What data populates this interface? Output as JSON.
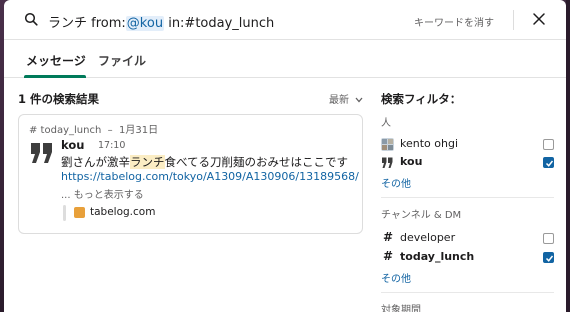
{
  "search": {
    "query_keyword": "ランチ",
    "query_from_label": "from:",
    "query_from_value": "@kou",
    "query_in": "in:#today_lunch",
    "clear_label": "キーワードを消す"
  },
  "tabs": [
    {
      "label": "メッセージ",
      "active": true
    },
    {
      "label": "ファイル",
      "active": false
    }
  ],
  "results": {
    "title": "1 件の検索結果",
    "sort_label": "最新"
  },
  "result": {
    "channel": "# today_lunch",
    "separator": "–",
    "date": "1月31日",
    "author": "kou",
    "time": "17:10",
    "text_before": "劉さんが激辛",
    "text_keyword": "ランチ",
    "text_after": "食べてる刀削麺のおみせはここです",
    "link": "https://tabelog.com/tokyo/A1309/A130906/13189568/",
    "show_more": "... もっと表示する",
    "attachment": "tabelog.com"
  },
  "filters": {
    "title": "検索フィルタ：",
    "people_label": "人",
    "people": [
      {
        "name": "kento ohgi",
        "checked": false
      },
      {
        "name": "kou",
        "checked": true
      }
    ],
    "people_more": "その他",
    "channels_label": "チャンネル & DM",
    "channels": [
      {
        "name": "developer",
        "checked": false
      },
      {
        "name": "today_lunch",
        "checked": true
      }
    ],
    "channels_more": "その他",
    "period_label": "対象期間"
  },
  "colors": {
    "accent_tab": "#007a5a",
    "link": "#1264a3",
    "keyword_highlight": "#fbedc4",
    "checkbox_checked": "#1264a3"
  }
}
